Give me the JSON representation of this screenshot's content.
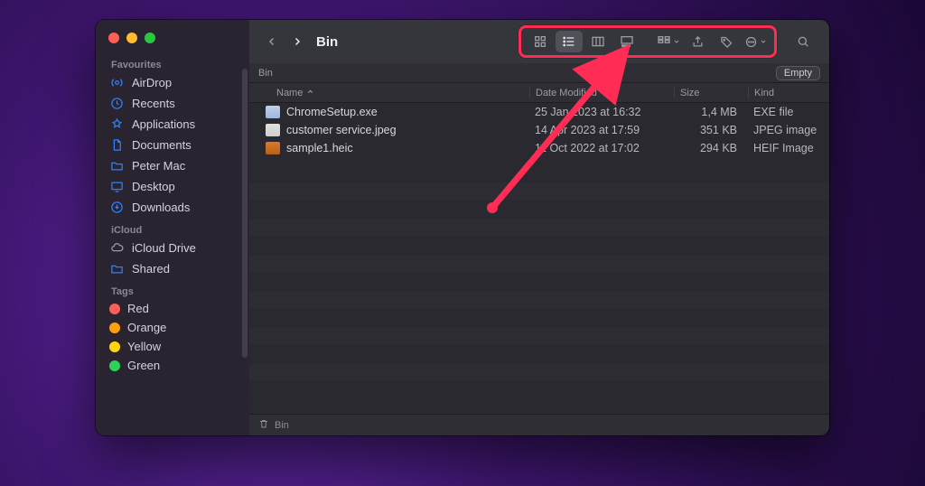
{
  "window": {
    "title": "Bin"
  },
  "sidebar": {
    "sections": [
      {
        "label": "Favourites",
        "items": [
          {
            "icon": "airdrop-icon",
            "label": "AirDrop"
          },
          {
            "icon": "clock-icon",
            "label": "Recents"
          },
          {
            "icon": "apps-icon",
            "label": "Applications"
          },
          {
            "icon": "doc-icon",
            "label": "Documents"
          },
          {
            "icon": "folder-icon",
            "label": "Peter Mac"
          },
          {
            "icon": "desktop-icon",
            "label": "Desktop"
          },
          {
            "icon": "download-icon",
            "label": "Downloads"
          }
        ]
      },
      {
        "label": "iCloud",
        "items": [
          {
            "icon": "cloud-icon",
            "label": "iCloud Drive"
          },
          {
            "icon": "shared-icon",
            "label": "Shared"
          }
        ]
      },
      {
        "label": "Tags",
        "items": [
          {
            "color": "#ff5f57",
            "label": "Red"
          },
          {
            "color": "#ff9f0a",
            "label": "Orange"
          },
          {
            "color": "#ffd60a",
            "label": "Yellow"
          },
          {
            "color": "#30d158",
            "label": "Green"
          }
        ]
      }
    ]
  },
  "pathbar": {
    "location": "Bin",
    "empty_button": "Empty"
  },
  "columns": {
    "name": "Name",
    "date": "Date Modified",
    "size": "Size",
    "kind": "Kind"
  },
  "files": [
    {
      "icon_bg": "linear-gradient(#bcd0e8,#9eb8d8)",
      "name": "ChromeSetup.exe",
      "date": "25 Jan 2023 at 16:32",
      "size": "1,4 MB",
      "kind": "EXE file"
    },
    {
      "icon_bg": "linear-gradient(#e0e0e0,#cfcfcf)",
      "name": "customer service.jpeg",
      "date": "14 Apr 2023 at 17:59",
      "size": "351 KB",
      "kind": "JPEG image"
    },
    {
      "icon_bg": "linear-gradient(#d97a2b,#b85f18)",
      "name": "sample1.heic",
      "date": "11 Oct 2022 at 17:02",
      "size": "294 KB",
      "kind": "HEIF Image"
    }
  ],
  "bottom_path": {
    "label": "Bin"
  }
}
